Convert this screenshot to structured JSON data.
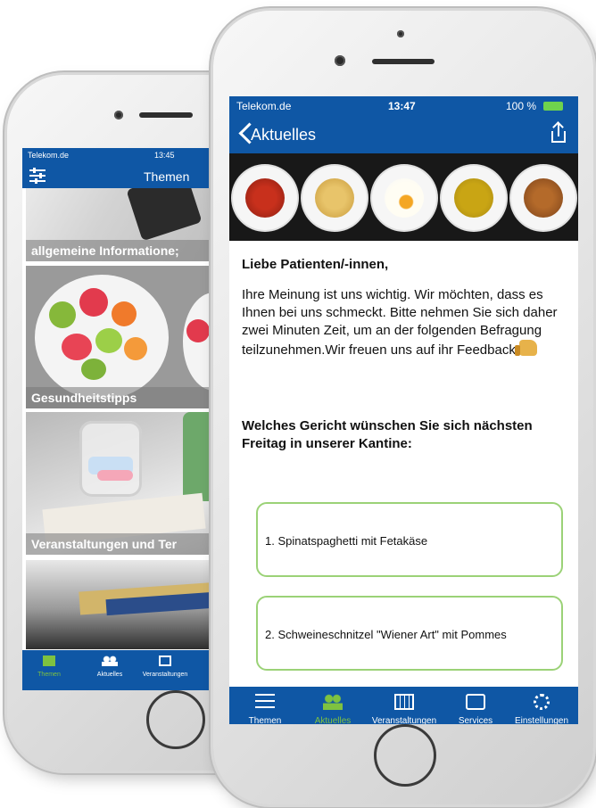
{
  "back_phone": {
    "status": {
      "carrier": "Telekom.de",
      "time": "13:45"
    },
    "nav_title": "Themen",
    "tiles": [
      {
        "label": "allgemeine Informatione;"
      },
      {
        "label": "Gesundheitstipps"
      },
      {
        "label": "Veranstaltungen und Ter"
      },
      {
        "label": ""
      }
    ],
    "tabs": [
      {
        "label": "Themen",
        "icon": "list-icon",
        "active": true
      },
      {
        "label": "Aktuelles",
        "icon": "people-icon",
        "active": false
      },
      {
        "label": "Veranstaltungen",
        "icon": "calendar-icon",
        "active": false
      }
    ]
  },
  "front_phone": {
    "status": {
      "carrier": "Telekom.de",
      "time": "13:47",
      "battery": "100 %"
    },
    "nav": {
      "back_label": "Aktuelles",
      "share_icon": "share-icon"
    },
    "greeting": "Liebe Patienten/-innen,",
    "paragraph": "Ihre Meinung ist uns wichtig. Wir möchten, dass es Ihnen bei uns schmeckt. Bitte nehmen Sie sich daher zwei Minuten Zeit, um an der folgenden Befragung teilzunehmen.Wir freuen uns auf ihr Feedback",
    "question": "Welches Gericht wünschen Sie sich nächsten Freitag in unserer Kantine:",
    "options": [
      "1. Spinatspaghetti mit Fetakäse",
      "2. Schweineschnitzel \"Wiener Art\" mit Pommes"
    ],
    "tabs": [
      {
        "label": "Themen",
        "icon": "list-icon",
        "active": false
      },
      {
        "label": "Aktuelles",
        "icon": "people-icon",
        "active": true
      },
      {
        "label": "Veranstaltungen",
        "icon": "calendar-icon",
        "active": false
      },
      {
        "label": "Services",
        "icon": "services-icon",
        "active": false
      },
      {
        "label": "Einstellungen",
        "icon": "gear-icon",
        "active": false
      }
    ]
  },
  "colors": {
    "brand_blue": "#0f57a5",
    "accent_green": "#7ec240",
    "option_border": "#9bd277"
  }
}
